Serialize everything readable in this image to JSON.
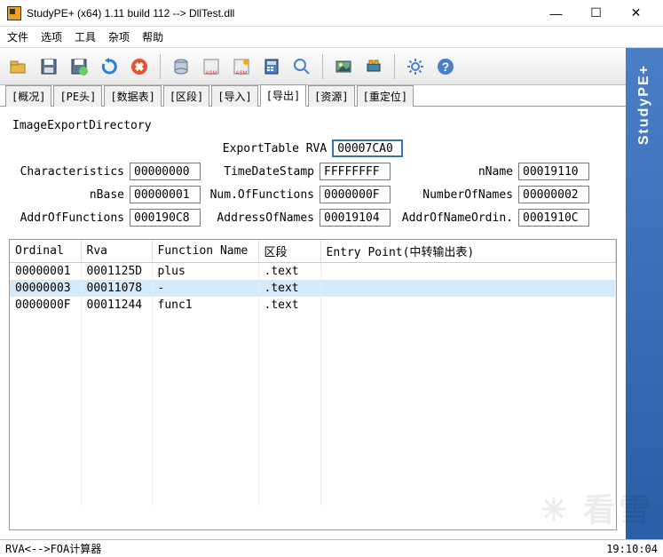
{
  "window": {
    "title": "StudyPE+ (x64) 1.11 build 112  -->  DllTest.dll"
  },
  "menu": {
    "file": "文件",
    "options": "选项",
    "tools": "工具",
    "misc": "杂项",
    "help": "帮助"
  },
  "side": {
    "app_name": "StudyPE+"
  },
  "tabs": {
    "overview": "[概况]",
    "pehead": "[PE头]",
    "datatable": "[数据表]",
    "sections": "[区段]",
    "imports": "[导入]",
    "exports": "[导出]",
    "resources": "[资源]",
    "reloc": "[重定位]"
  },
  "export": {
    "section_title": "ImageExportDirectory",
    "rva_label": "ExportTable RVA",
    "rva_value": "00007CA0",
    "characteristics_label": "Characteristics",
    "characteristics_value": "00000000",
    "timestamp_label": "TimeDateStamp",
    "timestamp_value": "FFFFFFFF",
    "nname_label": "nName",
    "nname_value": "00019110",
    "nbase_label": "nBase",
    "nbase_value": "00000001",
    "nfuncs_label": "Num.OfFunctions",
    "nfuncs_value": "0000000F",
    "nnames_label": "NumberOfNames",
    "nnames_value": "00000002",
    "addrfuncs_label": "AddrOfFunctions",
    "addrfuncs_value": "000190C8",
    "addrnames_label": "AddressOfNames",
    "addrnames_value": "00019104",
    "addrordin_label": "AddrOfNameOrdin.",
    "addrordin_value": "0001910C"
  },
  "table": {
    "col_ordinal": "Ordinal",
    "col_rva": "Rva",
    "col_funcname": "Function Name",
    "col_section": "区段",
    "col_entry": "Entry Point(中转输出表)",
    "rows": [
      {
        "ordinal": "00000001",
        "rva": "0001125D",
        "name": "plus",
        "sec": ".text",
        "ep": ""
      },
      {
        "ordinal": "00000003",
        "rva": "00011078",
        "name": "-",
        "sec": ".text",
        "ep": ""
      },
      {
        "ordinal": "0000000F",
        "rva": "00011244",
        "name": "func1",
        "sec": ".text",
        "ep": ""
      }
    ]
  },
  "status": {
    "left": "RVA<-->FOA计算器",
    "right": "19:10:04"
  },
  "watermark": "✳ 看雪"
}
